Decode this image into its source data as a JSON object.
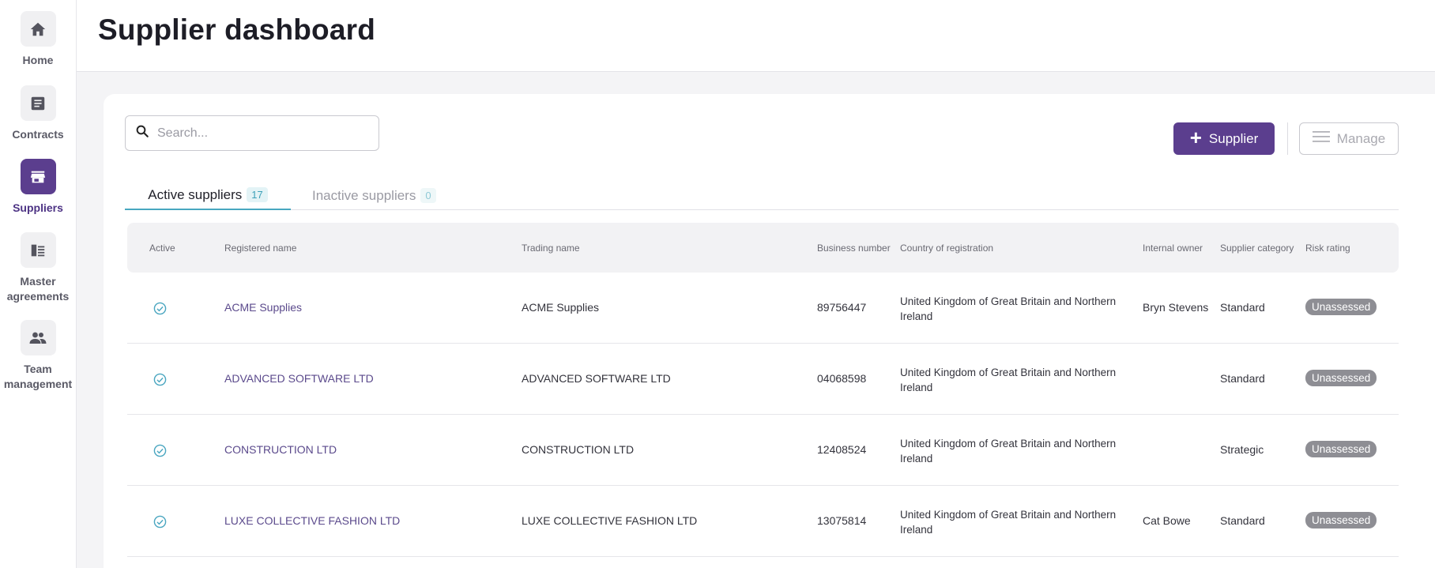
{
  "sidebar": {
    "items": [
      {
        "label": "Home",
        "icon": "home-icon"
      },
      {
        "label": "Contracts",
        "icon": "document-icon"
      },
      {
        "label": "Suppliers",
        "icon": "store-icon",
        "active": true
      },
      {
        "label": "Master agreements",
        "icon": "agreements-icon"
      },
      {
        "label": "Team management",
        "icon": "people-icon"
      }
    ]
  },
  "header": {
    "title": "Supplier dashboard"
  },
  "toolbar": {
    "search_placeholder": "Search...",
    "add_supplier_label": "Supplier",
    "manage_label": "Manage"
  },
  "tabs": [
    {
      "label": "Active suppliers",
      "count": "17"
    },
    {
      "label": "Inactive suppliers",
      "count": "0"
    }
  ],
  "table": {
    "columns": [
      "Active",
      "Registered name",
      "Trading name",
      "Business number",
      "Country of registration",
      "Internal owner",
      "Supplier category",
      "Risk rating"
    ],
    "rows": [
      {
        "registered_name": "ACME Supplies",
        "trading_name": "ACME Supplies",
        "business_number": "89756447",
        "country": "United Kingdom of Great Britain and Northern Ireland",
        "owner": "Bryn Stevens",
        "category": "Standard",
        "risk": "Unassessed"
      },
      {
        "registered_name": "ADVANCED SOFTWARE LTD",
        "trading_name": "ADVANCED SOFTWARE LTD",
        "business_number": "04068598",
        "country": "United Kingdom of Great Britain and Northern Ireland",
        "owner": "",
        "category": "Standard",
        "risk": "Unassessed"
      },
      {
        "registered_name": "CONSTRUCTION LTD",
        "trading_name": "CONSTRUCTION LTD",
        "business_number": "12408524",
        "country": "United Kingdom of Great Britain and Northern Ireland",
        "owner": "",
        "category": "Strategic",
        "risk": "Unassessed"
      },
      {
        "registered_name": "LUXE COLLECTIVE FASHION LTD",
        "trading_name": "LUXE COLLECTIVE FASHION LTD",
        "business_number": "13075814",
        "country": "United Kingdom of Great Britain and Northern Ireland",
        "owner": "Cat Bowe",
        "category": "Standard",
        "risk": "Unassessed"
      }
    ]
  },
  "colors": {
    "primary": "#5b3e8e",
    "accent_teal": "#48a7c0",
    "badge_grey": "#8e8e94"
  }
}
